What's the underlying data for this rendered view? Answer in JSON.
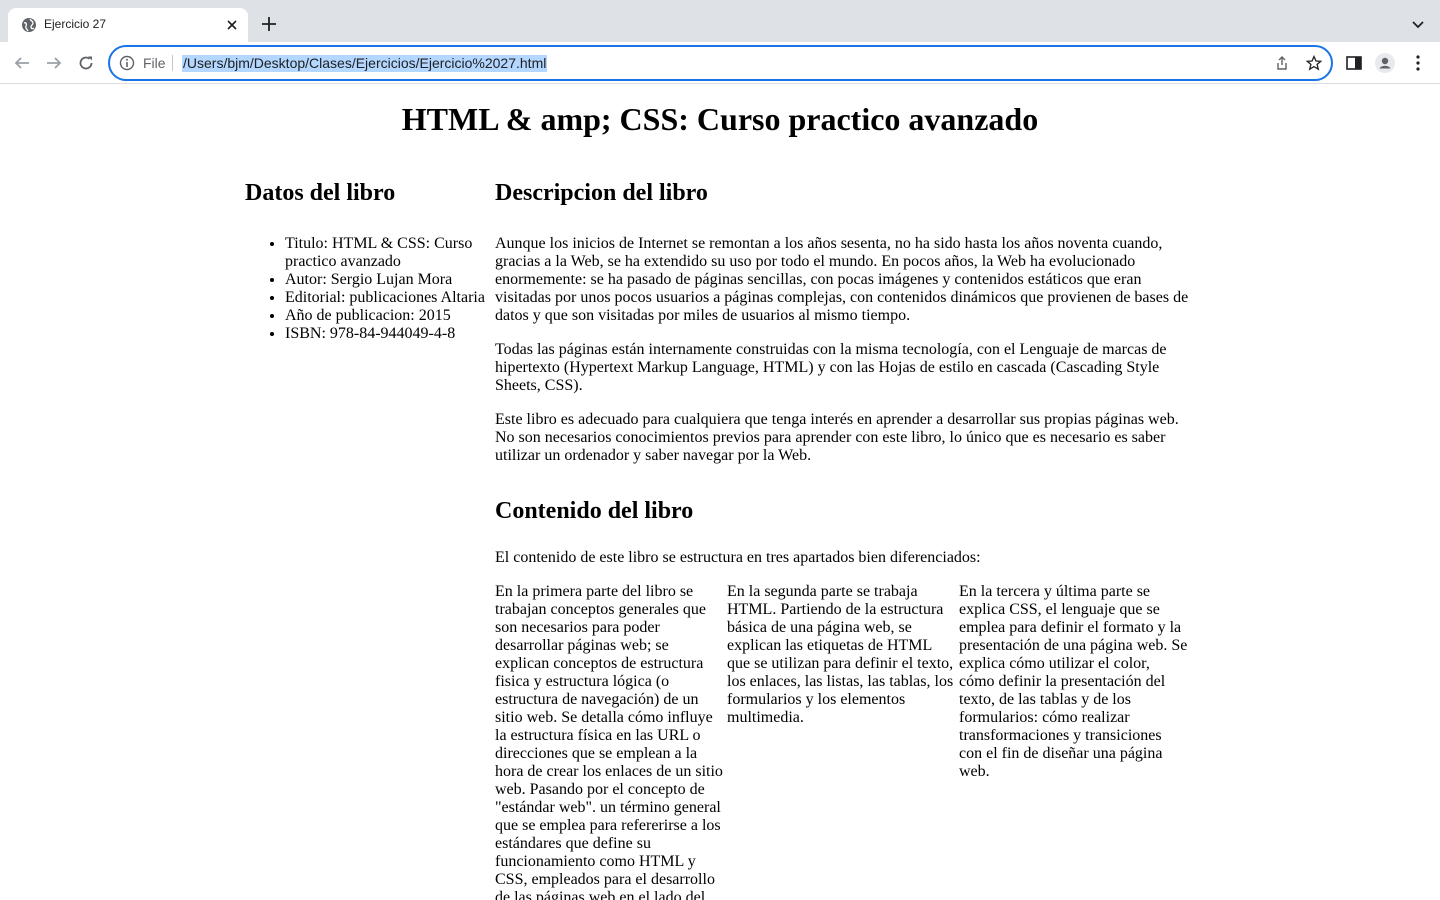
{
  "browser": {
    "tab_title": "Ejercicio 27",
    "scheme_label": "File",
    "url": "/Users/bjm/Desktop/Clases/Ejercicios/Ejercicio%2027.html"
  },
  "page": {
    "title": "HTML & amp; CSS: Curso practico avanzado",
    "details": {
      "heading": "Datos del libro",
      "items": [
        "Titulo: HTML & CSS: Curso practico avanzado",
        "Autor: Sergio Lujan Mora",
        "Editorial: publicaciones Altaria",
        "Año de publicacion: 2015",
        "ISBN: 978-84-944049-4-8"
      ]
    },
    "description": {
      "heading": "Descripcion del libro",
      "paragraphs": [
        "Aunque los inicios de Internet se remontan a los años sesenta, no ha sido hasta los años noventa cuando, gracias a la Web, se ha extendido su uso por todo el mundo. En pocos años, la Web ha evolucionado enormemente: se ha pasado de páginas sencillas, con pocas imágenes y contenidos estáticos que eran visitadas por unos pocos usuarios a páginas complejas, con contenidos dinámicos que provienen de bases de datos y que son visitadas por miles de usuarios al mismo tiempo.",
        "Todas las páginas están internamente construidas con la misma tecnología, con el Lenguaje de marcas de hipertexto (Hypertext Markup Language, HTML) y con las Hojas de estilo en cascada (Cascading Style Sheets, CSS).",
        "Este libro es adecuado para cualquiera que tenga interés en aprender a desarrollar sus propias páginas web. No son necesarios conocimientos previos para aprender con este libro, lo único que es necesario es saber utilizar un ordenador y saber navegar por la Web."
      ]
    },
    "contents": {
      "heading": "Contenido del libro",
      "intro": "El contenido de este libro se estructura en tres apartados bien diferenciados:",
      "columns": [
        "En la primera parte del libro se trabajan conceptos generales que son necesarios para poder desarrollar páginas web; se explican conceptos de estructura fisica y estructura lógica (o estructura de navegación) de un sitio web. Se detalla cómo influye la estructura física en las URL o direcciones que se emplean a la hora de crear los enlaces de un sitio web. Pasando por el concepto de \"estándar web\". un término general que se emplea para refererirse a los estándares que define su funcionamiento como HTML y CSS, empleados para el desarrollo de las páginas web en el lado del cliente.",
        "En la segunda parte se trabaja HTML. Partiendo de la estructura básica de una página web, se explican las etiquetas de HTML que se utilizan para definir el texto, los enlaces, las listas, las tablas, los formularios y los elementos multimedia.",
        "En la tercera y última parte se explica CSS, el lenguaje que se emplea para definir el formato y la presentación de una página web. Se explica cómo utilizar el color, cómo definir la presentación del texto, de las tablas y de los formularios: cómo realizar transformaciones y transiciones con el fin de diseñar una página web."
      ]
    }
  }
}
